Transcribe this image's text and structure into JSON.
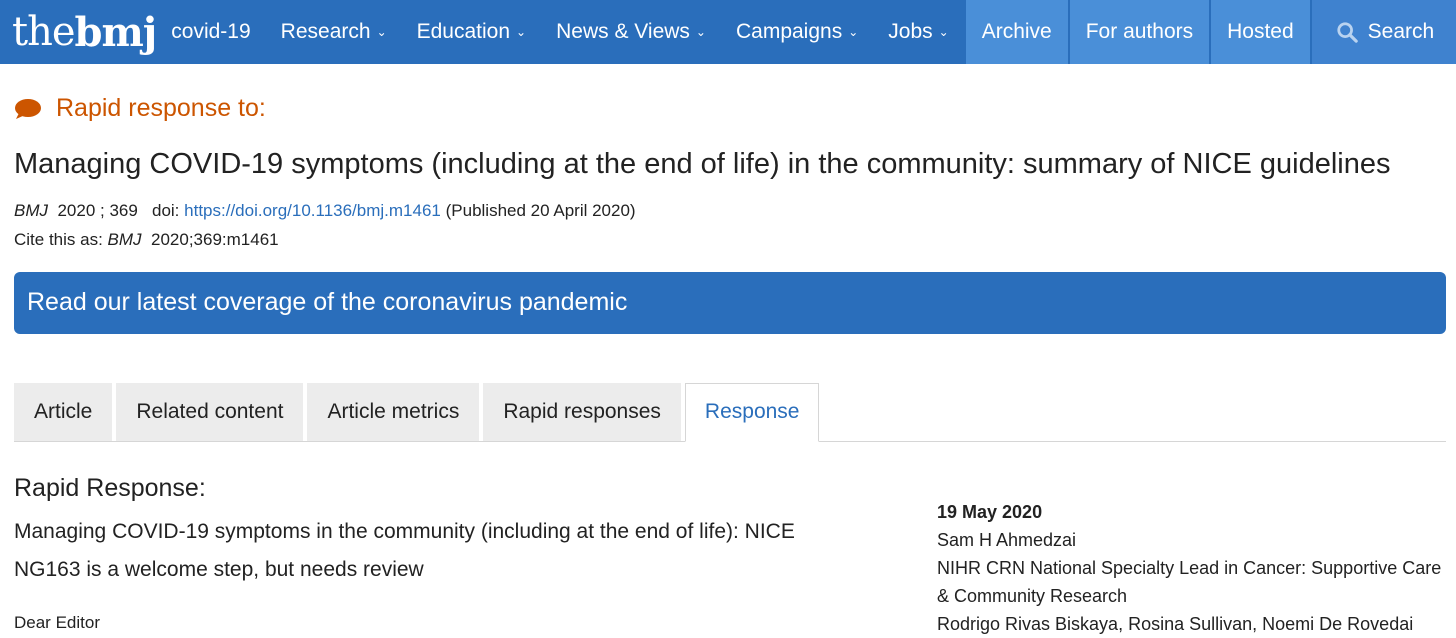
{
  "nav": {
    "logo_the": "the",
    "logo_bmj": "bmj",
    "items": [
      {
        "label": "covid-19",
        "has_menu": false
      },
      {
        "label": "Research",
        "has_menu": true
      },
      {
        "label": "Education",
        "has_menu": true
      },
      {
        "label": "News & Views",
        "has_menu": true
      },
      {
        "label": "Campaigns",
        "has_menu": true
      },
      {
        "label": "Jobs",
        "has_menu": true
      }
    ],
    "archive": "Archive",
    "for_authors": "For authors",
    "hosted": "Hosted",
    "search": "Search",
    "chevron": "⌄"
  },
  "article": {
    "rr_heading": "Rapid response to:",
    "title": "Managing COVID-19 symptoms (including at the end of life) in the community: summary of NICE guidelines",
    "journal": "BMJ",
    "year_vol": "2020 ; 369",
    "doi_label": "doi:",
    "doi_url": "https://doi.org/10.1136/bmj.m1461",
    "published": "(Published 20 April 2020)",
    "cite_label": "Cite this as:",
    "cite_journal": "BMJ",
    "cite_ref": "2020;369:m1461"
  },
  "banner": {
    "text": "Read our latest coverage of the coronavirus pandemic"
  },
  "tabs": [
    {
      "label": "Article"
    },
    {
      "label": "Related content"
    },
    {
      "label": "Article metrics"
    },
    {
      "label": "Rapid responses"
    },
    {
      "label": "Response"
    }
  ],
  "response": {
    "label": "Rapid Response:",
    "title": "Managing COVID-19 symptoms in the community (including at the end of life): NICE NG163 is a welcome step, but needs review",
    "salutation": "Dear Editor",
    "date": "19 May 2020",
    "author": "Sam H Ahmedzai",
    "role": "NIHR CRN National Specialty Lead in Cancer: Supportive Care & Community Research",
    "cut_line": "Rodrigo Rivas Biskaya, Rosina Sullivan, Noemi De Rovedai"
  },
  "colors": {
    "brand_blue": "#2a6ebb",
    "accent_orange": "#cc5500"
  }
}
